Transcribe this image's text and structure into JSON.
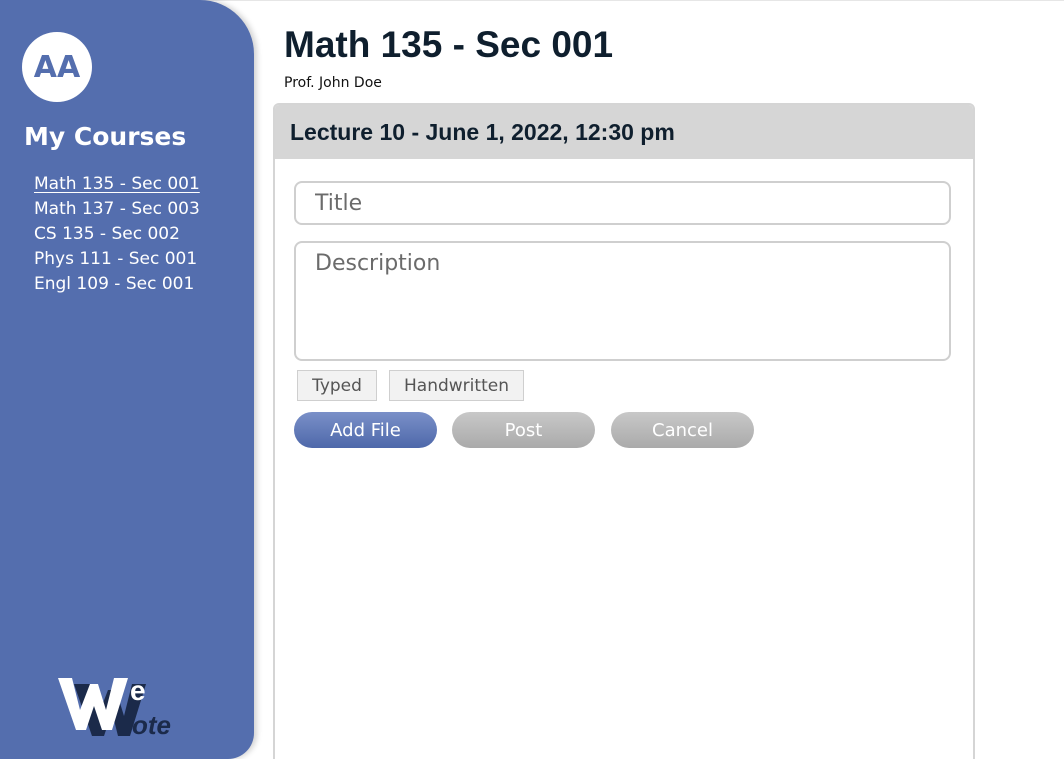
{
  "user": {
    "initials": "AA"
  },
  "sidebar": {
    "title": "My Courses",
    "courses": [
      {
        "label": "Math 135 - Sec 001",
        "active": true
      },
      {
        "label": "Math 137 - Sec 003",
        "active": false
      },
      {
        "label": "CS 135 - Sec 002",
        "active": false
      },
      {
        "label": "Phys 111 - Sec 001",
        "active": false
      },
      {
        "label": "Engl 109 - Sec 001",
        "active": false
      }
    ],
    "logo_text": "WeNote"
  },
  "header": {
    "title": "Math 135 - Sec 001",
    "professor": "Prof. John Doe"
  },
  "lecture": {
    "heading": "Lecture 10 - June 1, 2022, 12:30 pm",
    "title_placeholder": "Title",
    "description_placeholder": "Description",
    "modes": [
      "Typed",
      "Handwritten"
    ],
    "buttons": {
      "add_file": "Add File",
      "post": "Post",
      "cancel": "Cancel"
    }
  },
  "colors": {
    "sidebar_bg": "#546eae",
    "primary_button": "#5d76b6",
    "disabled_button": "#b4b4b4",
    "header_bg": "#d6d6d6",
    "title_text": "#0f1f2e"
  }
}
